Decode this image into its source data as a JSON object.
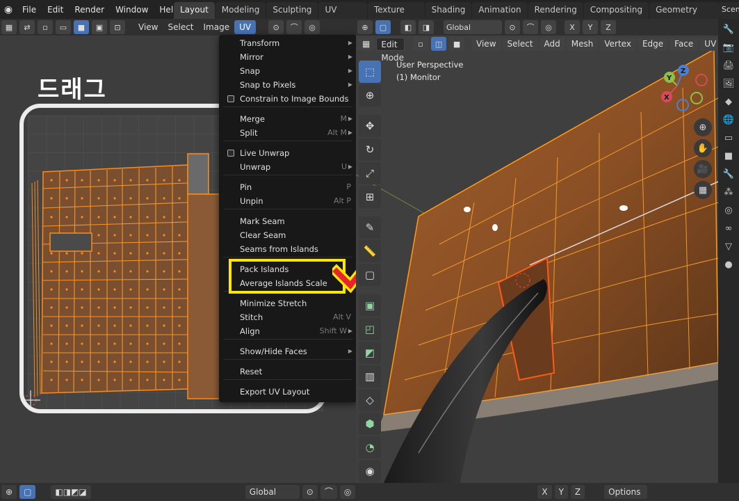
{
  "app": {
    "menus": [
      "File",
      "Edit",
      "Render",
      "Window",
      "Help"
    ]
  },
  "workspace_tabs": [
    "Layout",
    "Modeling",
    "Sculpting",
    "UV Editing",
    "Texture Paint",
    "Shading",
    "Animation",
    "Rendering",
    "Compositing",
    "Geometry Nodes",
    "S"
  ],
  "active_tab": "Layout",
  "scene_label": "Scen",
  "uv_editor": {
    "header_menus": [
      "View",
      "Select",
      "Image",
      "UV"
    ],
    "active_menu": "UV"
  },
  "annotation": {
    "drag_text": "드래그",
    "highlight_color": "#ffe600",
    "check_color": "#e8232e"
  },
  "uv_menu": {
    "items": [
      {
        "label": "Transform",
        "shortcut": "",
        "submenu": true,
        "checkbox": false
      },
      {
        "label": "Mirror",
        "shortcut": "",
        "submenu": true,
        "checkbox": false
      },
      {
        "label": "Snap",
        "shortcut": "",
        "submenu": true,
        "checkbox": false
      },
      {
        "label": "Snap to Pixels",
        "shortcut": "",
        "submenu": true,
        "checkbox": false
      },
      {
        "label": "Constrain to Image Bounds",
        "shortcut": "",
        "submenu": false,
        "checkbox": true
      },
      {
        "label": "Merge",
        "shortcut": "M",
        "submenu": true,
        "checkbox": false
      },
      {
        "label": "Split",
        "shortcut": "Alt M",
        "submenu": true,
        "checkbox": false
      },
      {
        "label": "Live Unwrap",
        "shortcut": "",
        "submenu": false,
        "checkbox": true
      },
      {
        "label": "Unwrap",
        "shortcut": "U",
        "submenu": true,
        "checkbox": false
      },
      {
        "label": "Pin",
        "shortcut": "P",
        "submenu": false,
        "checkbox": false
      },
      {
        "label": "Unpin",
        "shortcut": "Alt P",
        "submenu": false,
        "checkbox": false
      },
      {
        "label": "Mark Seam",
        "shortcut": "",
        "submenu": false,
        "checkbox": false
      },
      {
        "label": "Clear Seam",
        "shortcut": "",
        "submenu": false,
        "checkbox": false
      },
      {
        "label": "Seams from Islands",
        "shortcut": "",
        "submenu": false,
        "checkbox": false
      },
      {
        "label": "Pack Islands",
        "shortcut": "",
        "submenu": false,
        "checkbox": false
      },
      {
        "label": "Average Islands Scale",
        "shortcut": "",
        "submenu": false,
        "checkbox": false
      },
      {
        "label": "Minimize Stretch",
        "shortcut": "",
        "submenu": false,
        "checkbox": false
      },
      {
        "label": "Stitch",
        "shortcut": "Alt V",
        "submenu": false,
        "checkbox": false
      },
      {
        "label": "Align",
        "shortcut": "Shift W",
        "submenu": true,
        "checkbox": false
      },
      {
        "label": "Show/Hide Faces",
        "shortcut": "",
        "submenu": true,
        "checkbox": false
      },
      {
        "label": "Reset",
        "shortcut": "",
        "submenu": false,
        "checkbox": false
      },
      {
        "label": "Export UV Layout",
        "shortcut": "",
        "submenu": false,
        "checkbox": false
      }
    ]
  },
  "viewport": {
    "header": {
      "transform_orientation": "Global",
      "axes": [
        "X",
        "Y",
        "Z"
      ]
    },
    "mode": "Edit Mode",
    "header_menus": [
      "View",
      "Select",
      "Add",
      "Mesh",
      "Vertex",
      "Edge",
      "Face",
      "UV"
    ],
    "info_line1": "User Perspective",
    "info_line2": "(1) Monitor",
    "gizmo": {
      "x": "X",
      "y": "Y",
      "z": "Z"
    }
  },
  "bottom_bar": {
    "transform_orientation": "Global",
    "axes": [
      "X",
      "Y",
      "Z"
    ],
    "options_label": "Options"
  }
}
